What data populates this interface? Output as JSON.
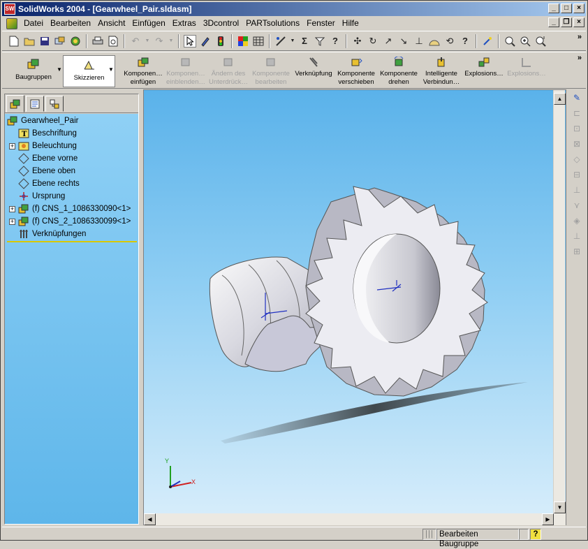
{
  "window": {
    "title": "SolidWorks 2004 - [Gearwheel_Pair.sldasm]",
    "app_icon_text": "SW"
  },
  "title_buttons": {
    "minimize": "_",
    "maximize": "□",
    "close": "×"
  },
  "menu": [
    "Datei",
    "Bearbeiten",
    "Ansicht",
    "Einfügen",
    "Extras",
    "3Dcontrol",
    "PARTsolutions",
    "Fenster",
    "Hilfe"
  ],
  "mdi_buttons": {
    "minimize": "_",
    "restore": "❐",
    "close": "×"
  },
  "standard_toolbar": {
    "icons": [
      "new-icon",
      "open-icon",
      "save-icon",
      "assembly-from-part-icon",
      "print-icon",
      "print-preview-icon",
      "undo-icon",
      "redo-icon",
      "select-icon",
      "sketch-icon",
      "rebuild-icon",
      "color-icon",
      "grid-icon",
      "smart-mate-icon",
      "sum-icon",
      "filter-icon",
      "help-icon",
      "view-orient-icon",
      "rotate-icon",
      "line-icon",
      "arrow-icon",
      "normal-icon",
      "sky-icon",
      "refresh-icon",
      "question-icon",
      "wizard-icon",
      "zoom-fit-icon",
      "zoom-in-icon",
      "zoom-area-icon"
    ],
    "overflow": "»"
  },
  "command_manager": {
    "modes": [
      {
        "label": "Baugruppen",
        "active": false
      },
      {
        "label": "Skizzieren",
        "active": true
      }
    ],
    "commands": [
      {
        "label1": "Komponen…",
        "label2": "einfügen",
        "enabled": true
      },
      {
        "label1": "Komponen…",
        "label2": "einblenden…",
        "enabled": false
      },
      {
        "label1": "Ändern des",
        "label2": "Unterdrück…",
        "enabled": false
      },
      {
        "label1": "Komponente",
        "label2": "bearbeiten",
        "enabled": false
      },
      {
        "label1": "Verknüpfung",
        "label2": "",
        "enabled": true
      },
      {
        "label1": "Komponente",
        "label2": "verschieben",
        "enabled": true
      },
      {
        "label1": "Komponente",
        "label2": "drehen",
        "enabled": true
      },
      {
        "label1": "Intelligente",
        "label2": "Verbindun…",
        "enabled": true
      },
      {
        "label1": "Explosions…",
        "label2": "",
        "enabled": true
      },
      {
        "label1": "Explosions…",
        "label2": "",
        "enabled": false
      }
    ],
    "overflow": "»"
  },
  "feature_tree": {
    "root": "Gearwheel_Pair",
    "items": [
      {
        "label": "Beschriftung",
        "icon": "annotation-icon",
        "expandable": false
      },
      {
        "label": "Beleuchtung",
        "icon": "lighting-icon",
        "expandable": true
      },
      {
        "label": "Ebene vorne",
        "icon": "plane-icon",
        "expandable": false
      },
      {
        "label": "Ebene oben",
        "icon": "plane-icon",
        "expandable": false
      },
      {
        "label": "Ebene rechts",
        "icon": "plane-icon",
        "expandable": false
      },
      {
        "label": "Ursprung",
        "icon": "origin-icon",
        "expandable": false
      },
      {
        "label": "(f) CNS_1_1086330090<1>",
        "icon": "component-icon",
        "expandable": true
      },
      {
        "label": "(f) CNS_2_1086330099<1>",
        "icon": "component-icon",
        "expandable": true
      },
      {
        "label": "Verknüpfungen",
        "icon": "mates-icon",
        "expandable": false
      }
    ]
  },
  "viewport": {
    "triad_x": "X",
    "triad_y": "Y"
  },
  "status_bar": {
    "mode": "Bearbeiten Baugruppe",
    "help": "?"
  }
}
